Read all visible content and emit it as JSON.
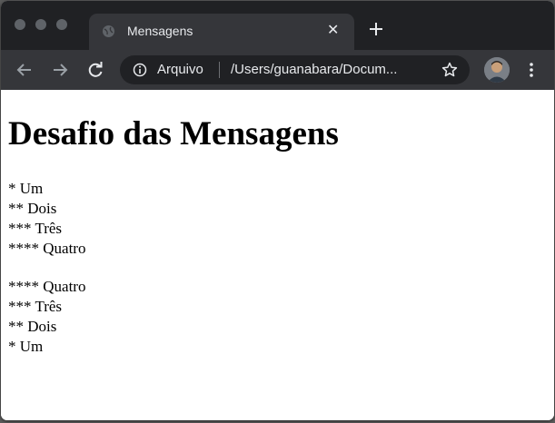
{
  "browser": {
    "tab": {
      "title": "Mensagens",
      "close": "✕"
    },
    "new_tab": "+",
    "address": {
      "scheme_label": "Arquivo",
      "url": "/Users/guanabara/Docum..."
    }
  },
  "page": {
    "heading": "Desafio das Mensagens",
    "group1": [
      "* Um",
      "** Dois",
      "*** Três",
      "**** Quatro"
    ],
    "group2": [
      "**** Quatro",
      "*** Três",
      "** Dois",
      "* Um"
    ]
  }
}
